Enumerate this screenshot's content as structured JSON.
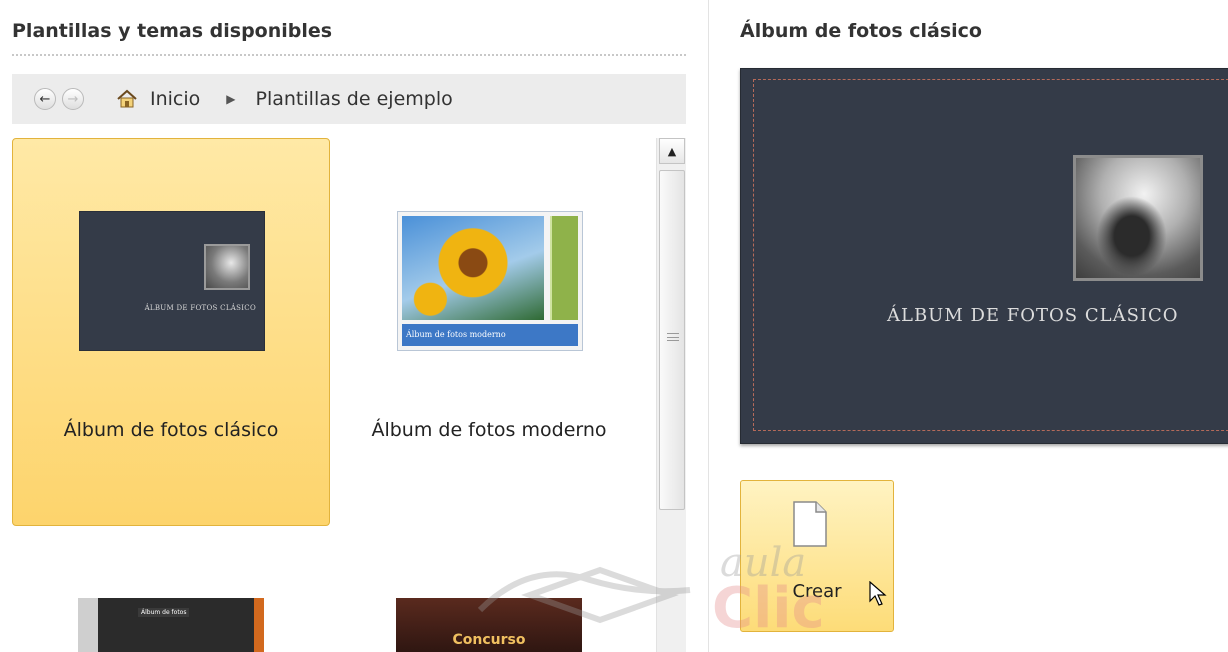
{
  "left_panel": {
    "title": "Plantillas y temas disponibles",
    "breadcrumb": {
      "home": "Inicio",
      "current": "Plantillas de ejemplo"
    },
    "templates": [
      {
        "label": "Álbum de fotos clásico",
        "thumb_caption": "ÁLBUM DE FOTOS CLÁSICO",
        "selected": true
      },
      {
        "label": "Álbum de fotos moderno",
        "thumb_caption": "Álbum de fotos moderno",
        "selected": false
      },
      {
        "label": "",
        "thumb_caption": "Álbum de fotos"
      },
      {
        "label": "",
        "thumb_caption": "Concurso"
      }
    ]
  },
  "right_panel": {
    "title": "Álbum de fotos clásico",
    "preview_caption": "ÁLBUM DE FOTOS CLÁSICO",
    "create_label": "Crear"
  },
  "watermark": {
    "line1": "aula",
    "line2": "Clic"
  },
  "colors": {
    "selected_tile": "#fdd46c",
    "preview_bg": "#343b48",
    "accent_border": "#e2b33c"
  }
}
